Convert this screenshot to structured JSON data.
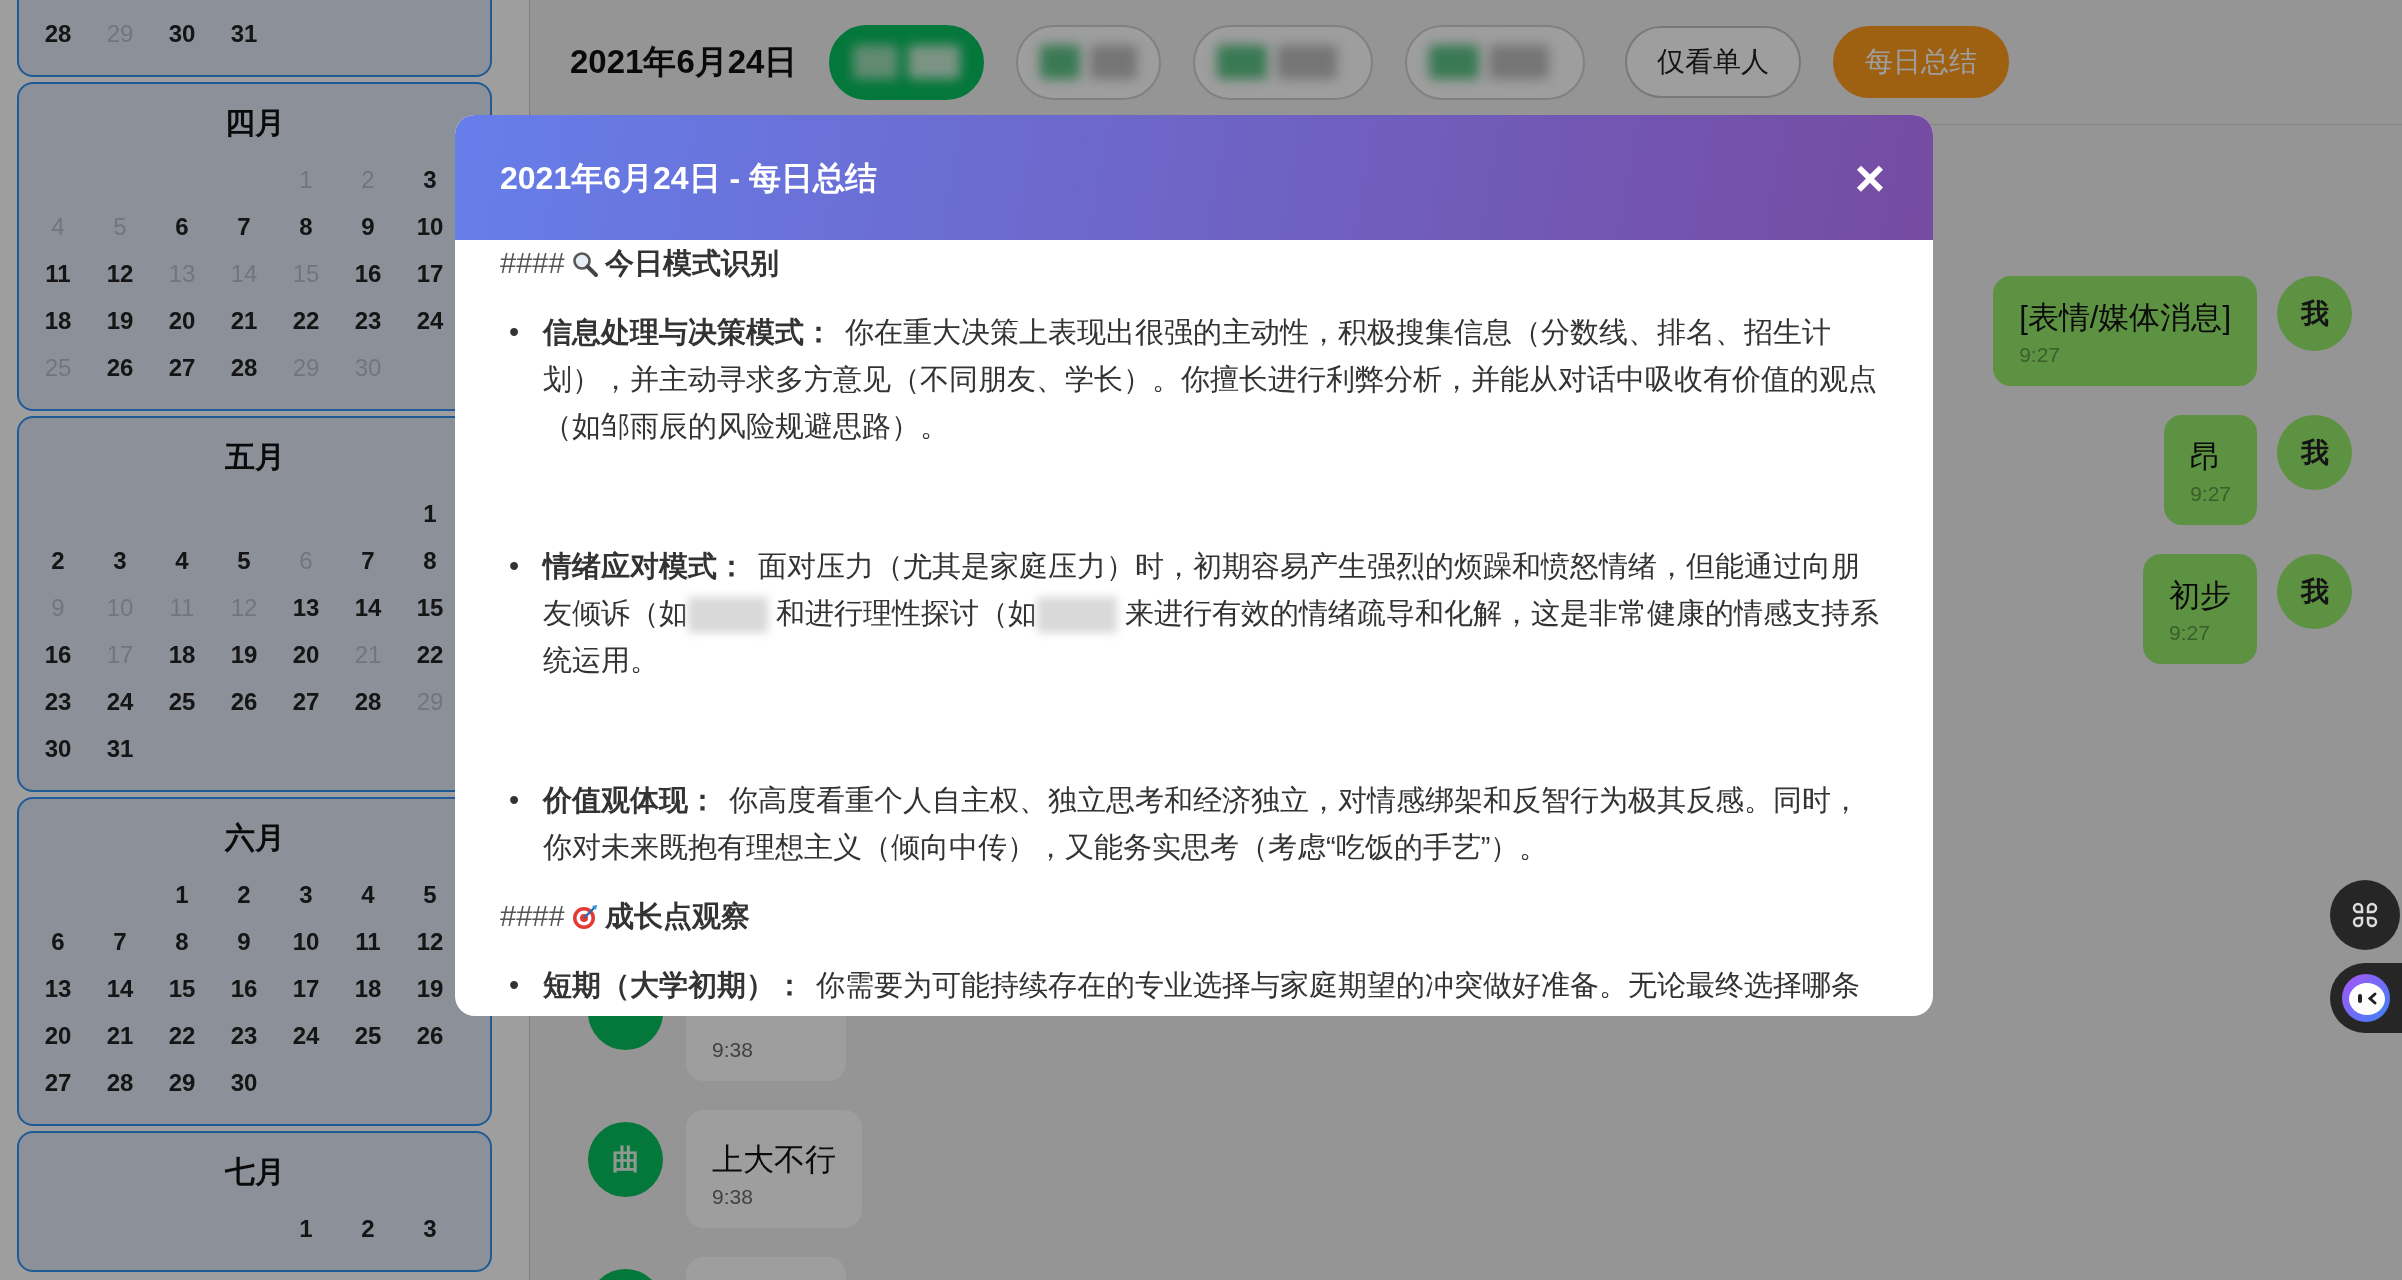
{
  "sidebar": {
    "months": [
      {
        "weeks": [
          [
            {
              "day": "28",
              "active": true
            },
            {
              "day": "29",
              "active": false
            },
            {
              "day": "30",
              "active": true
            },
            {
              "day": "31",
              "active": true
            }
          ]
        ]
      },
      {
        "title": "四月",
        "weeks": [
          [
            {
              "day": "1",
              "active": false
            },
            {
              "day": "2",
              "active": false
            },
            {
              "day": "3",
              "active": true
            }
          ],
          [
            {
              "day": "4",
              "active": false
            },
            {
              "day": "5",
              "active": false
            },
            {
              "day": "6",
              "active": true
            },
            {
              "day": "7",
              "active": true
            },
            {
              "day": "8",
              "active": true
            },
            {
              "day": "9",
              "active": true
            },
            {
              "day": "10",
              "active": true
            }
          ],
          [
            {
              "day": "11",
              "active": true
            },
            {
              "day": "12",
              "active": true
            },
            {
              "day": "13",
              "active": false
            },
            {
              "day": "14",
              "active": false
            },
            {
              "day": "15",
              "active": false
            },
            {
              "day": "16",
              "active": true
            },
            {
              "day": "17",
              "active": true
            }
          ],
          [
            {
              "day": "18",
              "active": true
            },
            {
              "day": "19",
              "active": true
            },
            {
              "day": "20",
              "active": true
            },
            {
              "day": "21",
              "active": true
            },
            {
              "day": "22",
              "active": true
            },
            {
              "day": "23",
              "active": true
            },
            {
              "day": "24",
              "active": true
            }
          ],
          [
            {
              "day": "25",
              "active": false
            },
            {
              "day": "26",
              "active": true
            },
            {
              "day": "27",
              "active": true
            },
            {
              "day": "28",
              "active": true
            },
            {
              "day": "29",
              "active": false
            },
            {
              "day": "30",
              "active": false
            }
          ]
        ]
      },
      {
        "title": "五月",
        "weeks": [
          [
            {
              "day": "1",
              "active": true
            }
          ],
          [
            {
              "day": "2",
              "active": true
            },
            {
              "day": "3",
              "active": true
            },
            {
              "day": "4",
              "active": true
            },
            {
              "day": "5",
              "active": true
            },
            {
              "day": "6",
              "active": false
            },
            {
              "day": "7",
              "active": true
            },
            {
              "day": "8",
              "active": true
            }
          ],
          [
            {
              "day": "9",
              "active": false
            },
            {
              "day": "10",
              "active": false
            },
            {
              "day": "11",
              "active": false
            },
            {
              "day": "12",
              "active": false
            },
            {
              "day": "13",
              "active": true
            },
            {
              "day": "14",
              "active": true
            },
            {
              "day": "15",
              "active": true
            }
          ],
          [
            {
              "day": "16",
              "active": true
            },
            {
              "day": "17",
              "active": false
            },
            {
              "day": "18",
              "active": true
            },
            {
              "day": "19",
              "active": true
            },
            {
              "day": "20",
              "active": true
            },
            {
              "day": "21",
              "active": false
            },
            {
              "day": "22",
              "active": true
            }
          ],
          [
            {
              "day": "23",
              "active": true
            },
            {
              "day": "24",
              "active": true
            },
            {
              "day": "25",
              "active": true
            },
            {
              "day": "26",
              "active": true
            },
            {
              "day": "27",
              "active": true
            },
            {
              "day": "28",
              "active": true
            },
            {
              "day": "29",
              "active": false
            }
          ],
          [
            {
              "day": "30",
              "active": true
            },
            {
              "day": "31",
              "active": true
            }
          ]
        ]
      },
      {
        "title": "六月",
        "weeks": [
          [
            {
              "day": "1",
              "active": true
            },
            {
              "day": "2",
              "active": true
            },
            {
              "day": "3",
              "active": true
            },
            {
              "day": "4",
              "active": true
            },
            {
              "day": "5",
              "active": true
            }
          ],
          [
            {
              "day": "6",
              "active": true
            },
            {
              "day": "7",
              "active": true
            },
            {
              "day": "8",
              "active": true
            },
            {
              "day": "9",
              "active": true
            },
            {
              "day": "10",
              "active": true
            },
            {
              "day": "11",
              "active": true
            },
            {
              "day": "12",
              "active": true
            }
          ],
          [
            {
              "day": "13",
              "active": true
            },
            {
              "day": "14",
              "active": true
            },
            {
              "day": "15",
              "active": true
            },
            {
              "day": "16",
              "active": true
            },
            {
              "day": "17",
              "active": true
            },
            {
              "day": "18",
              "active": true
            },
            {
              "day": "19",
              "active": true
            }
          ],
          [
            {
              "day": "20",
              "active": true
            },
            {
              "day": "21",
              "active": true
            },
            {
              "day": "22",
              "active": true
            },
            {
              "day": "23",
              "active": true
            },
            {
              "day": "24",
              "active": true
            },
            {
              "day": "25",
              "active": true
            },
            {
              "day": "26",
              "active": true
            }
          ],
          [
            {
              "day": "27",
              "active": true
            },
            {
              "day": "28",
              "active": true
            },
            {
              "day": "29",
              "active": true
            },
            {
              "day": "30",
              "active": true
            }
          ]
        ]
      },
      {
        "title": "七月",
        "weeks": [
          [
            {
              "day": "1",
              "active": true
            },
            {
              "day": "2",
              "active": true
            },
            {
              "day": "3",
              "active": true
            }
          ]
        ]
      }
    ]
  },
  "header": {
    "date": "2021年6月24日",
    "filter_chips": [
      {
        "selected": true
      },
      {
        "selected": false
      },
      {
        "selected": false
      },
      {
        "selected": false
      }
    ],
    "buttons": [
      {
        "label": "仅看单人",
        "kind": "outline"
      },
      {
        "label": "每日总结",
        "kind": "primary"
      }
    ]
  },
  "chat": {
    "messages": [
      {
        "kind": "outgoing",
        "avatar": "我",
        "text": "[表情/媒体消息]",
        "time": "9:27"
      },
      {
        "kind": "outgoing",
        "avatar": "我",
        "text": "昂",
        "time": "9:27"
      },
      {
        "kind": "outgoing",
        "avatar": "我",
        "text": "初步",
        "time": "9:27"
      },
      {
        "kind": "incoming",
        "time": "9:38"
      },
      {
        "kind": "incoming",
        "avatar": "曲",
        "text": "上大不行",
        "time": "9:38"
      },
      {
        "kind": "incoming"
      }
    ]
  },
  "modal": {
    "title": "2021年6月24日 - 每日总结",
    "close": "×",
    "sections": [
      {
        "hashes": "####",
        "kind": "search",
        "title": "今日模式识别",
        "bullets": [
          {
            "marker": "•",
            "label": "信息处理与决策模式：",
            "segments": [
              {
                "kind": "text",
                "text": "你在重大决策上表现出很强的主动性，积极搜集信息（分数线、排名、招生计划），并主动寻求多方意见（不同朋友、学长）。你擅长进行利弊分析，并能从对话中吸收有价值的观点（如邹雨辰的风险规避思路）。"
              }
            ]
          },
          {
            "marker": "•",
            "label": "情绪应对模式：",
            "segments": [
              {
                "kind": "text",
                "text": "面对压力（尤其是家庭压力）时，初期容易产生强烈的烦躁和愤怒情绪，但能通过向朋友倾诉（如"
              },
              {
                "kind": "redacted"
              },
              {
                "kind": "text",
                "text": " 和进行理性探讨（如"
              },
              {
                "kind": "redacted"
              },
              {
                "kind": "text",
                "text": " 来进行有效的情绪疏导和化解，这是非常健康的情感支持系统运用。"
              }
            ]
          },
          {
            "marker": "•",
            "label": "价值观体现：",
            "segments": [
              {
                "kind": "text",
                "text": "你高度看重个人自主权、独立思考和经济独立，对情感绑架和反智行为极其反感。同时，你对未来既抱有理想主义（倾向中传），又能务实思考（考虑“吃饭的手艺”）。"
              }
            ]
          }
        ]
      },
      {
        "hashes": "####",
        "kind": "target",
        "title": "成长点观察",
        "bullets": [
          {
            "marker": "•",
            "label": "短期（大学初期）：",
            "segments": [
              {
                "kind": "text",
                "text": "你需要为可能持续存在的专业选择与家庭期望的冲突做好准备。无论最终选择哪条"
              }
            ]
          }
        ]
      }
    ]
  }
}
